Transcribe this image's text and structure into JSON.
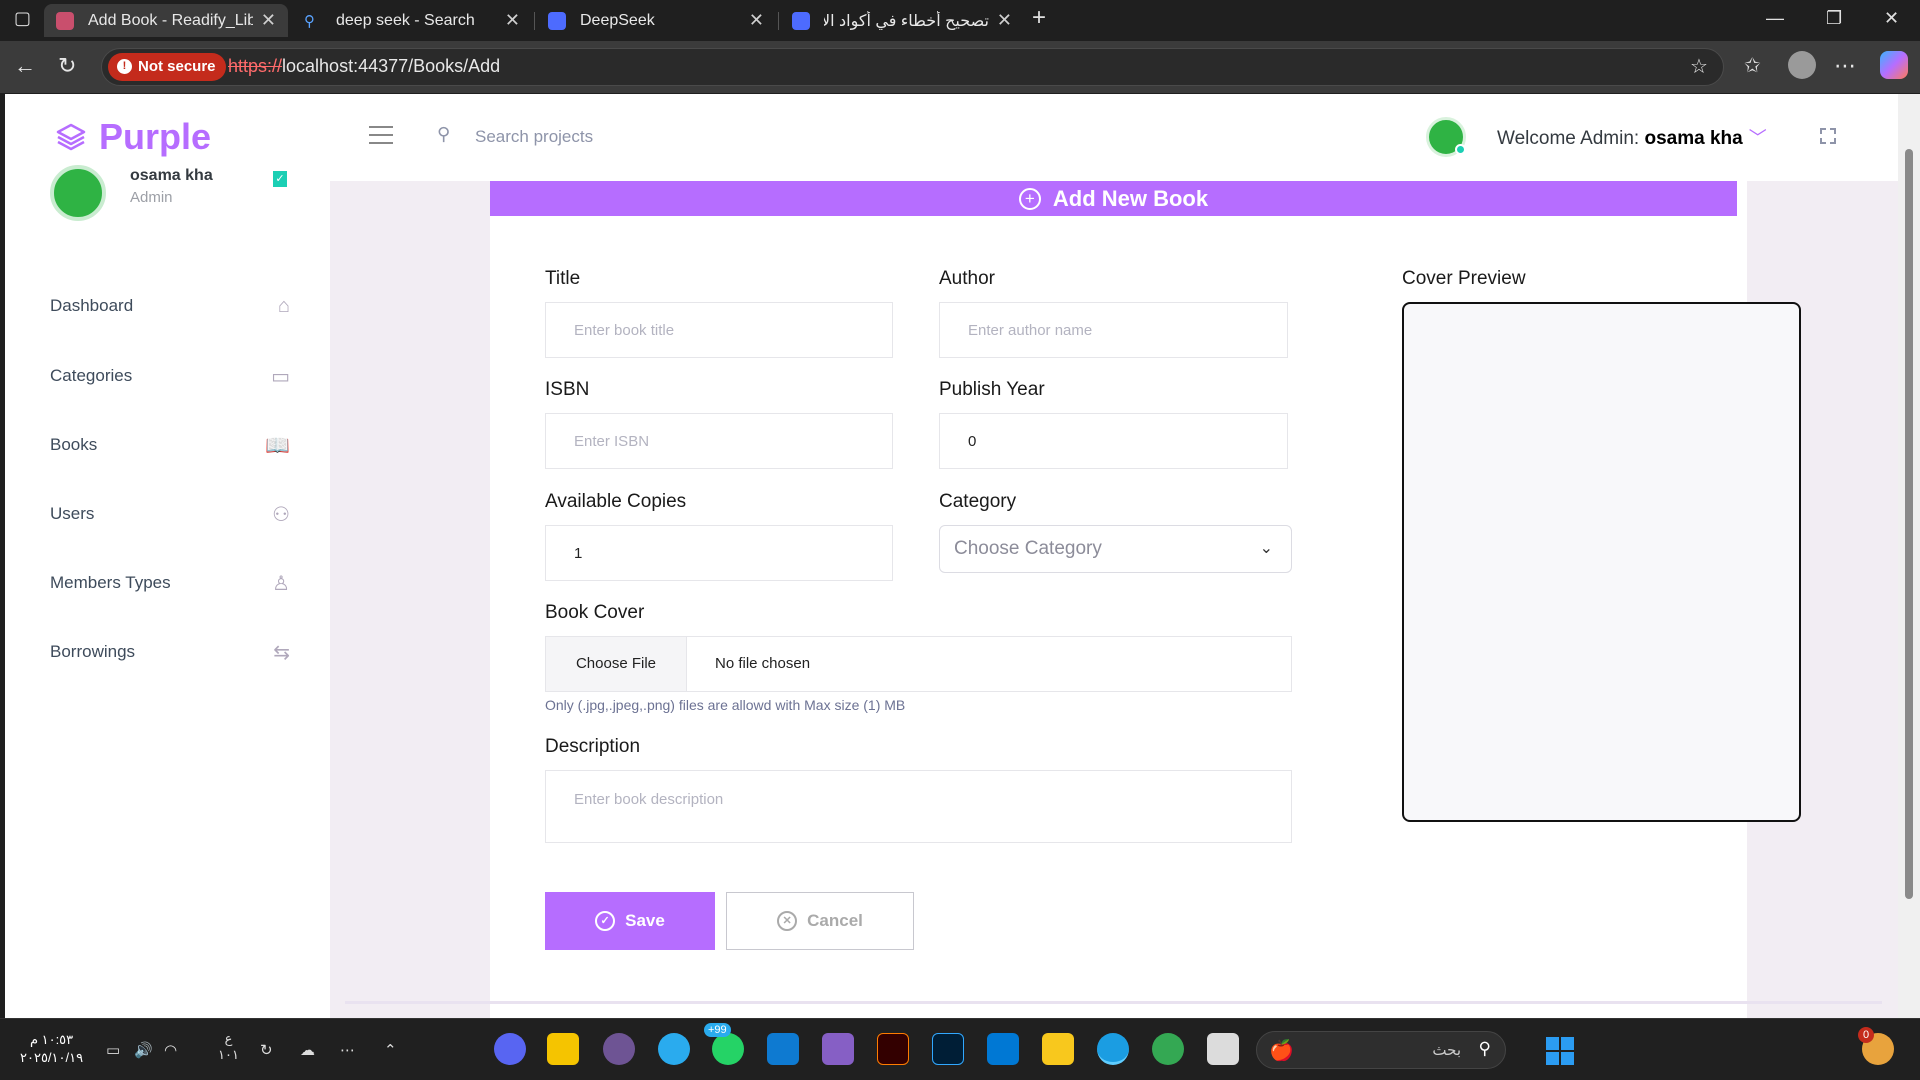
{
  "browser": {
    "tabs": [
      {
        "title": "Add Book - Readify_Library",
        "active": true,
        "favicon_color": "#c94f6d"
      },
      {
        "title": "deep seek - Search",
        "active": false,
        "favicon_color": "#3b82f6"
      },
      {
        "title": "DeepSeek",
        "active": false,
        "favicon_color": "#4d6bfe"
      },
      {
        "title": "تصحيح أخطاء في أكواد الإرجاع - eek",
        "active": false,
        "favicon_color": "#4d6bfe"
      }
    ],
    "new_tab": "+",
    "security_label": "Not secure",
    "url_protocol": "https://",
    "url_rest": "localhost:44377/Books/Add"
  },
  "app": {
    "brand": "Purple",
    "search_placeholder": "Search projects",
    "welcome_prefix": "Welcome Admin: ",
    "welcome_user": "osama kha",
    "accent": "#b66dff"
  },
  "sidebar": {
    "profile_name": "osama kha",
    "profile_role": "Admin",
    "items": [
      {
        "label": "Dashboard",
        "icon": "⌂"
      },
      {
        "label": "Categories",
        "icon": "▭"
      },
      {
        "label": "Books",
        "icon": "📖"
      },
      {
        "label": "Users",
        "icon": "⚇"
      },
      {
        "label": "Members Types",
        "icon": "♙"
      },
      {
        "label": "Borrowings",
        "icon": "⇆"
      }
    ]
  },
  "form": {
    "header": "Add New Book",
    "title_label": "Title",
    "title_placeholder": "Enter book title",
    "author_label": "Author",
    "author_placeholder": "Enter author name",
    "isbn_label": "ISBN",
    "isbn_placeholder": "Enter ISBN",
    "year_label": "Publish Year",
    "year_value": "0",
    "copies_label": "Available Copies",
    "copies_value": "1",
    "category_label": "Category",
    "category_value": "Choose Category",
    "cover_label": "Book Cover",
    "file_button": "Choose File",
    "file_status": "No file chosen",
    "file_hint": "Only (.jpg,.jpeg,.png) files are allowd with Max size (1) MB",
    "description_label": "Description",
    "description_placeholder": "Enter book description",
    "preview_label": "Cover Preview",
    "save_label": "Save",
    "cancel_label": "Cancel"
  },
  "taskbar": {
    "time": "١٠:٥٣ م",
    "date": "٢٠٢٥/١٠/١٩",
    "lang": "ع",
    "lang2": "١٠١",
    "search_label": "بحث",
    "notification_count": "0",
    "telegram_badge": "+99"
  }
}
